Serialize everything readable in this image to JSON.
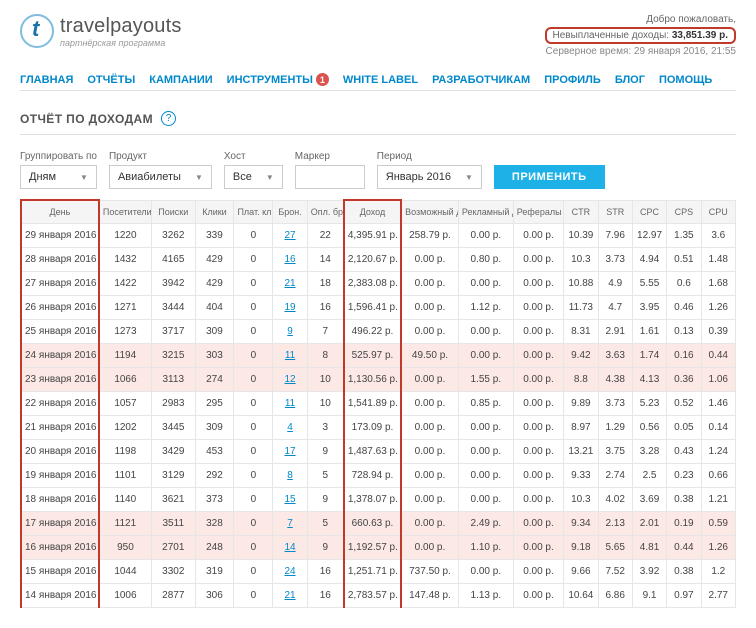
{
  "brand": {
    "title": "travelpayouts",
    "subtitle": "партнёрская программа"
  },
  "header": {
    "welcome": "Добро пожаловать,",
    "unpaid_label": "Невыплаченные доходы:",
    "unpaid_amount": "33,851.39 р.",
    "server_time": "Серверное время: 29 января 2016, 21:55"
  },
  "nav": {
    "main": "ГЛАВНАЯ",
    "reports": "ОТЧЁТЫ",
    "campaigns": "КАМПАНИИ",
    "tools": "ИНСТРУМЕНТЫ",
    "tools_badge": "1",
    "whitelabel": "WHITE LABEL",
    "devs": "РАЗРАБОТЧИКАМ",
    "profile": "ПРОФИЛЬ",
    "blog": "БЛОГ",
    "help": "ПОМОЩЬ"
  },
  "report": {
    "title": "ОТЧЁТ ПО ДОХОДАМ"
  },
  "filters": {
    "group_label": "Группировать по",
    "group_value": "Дням",
    "product_label": "Продукт",
    "product_value": "Авиабилеты",
    "host_label": "Хост",
    "host_value": "Все",
    "marker_label": "Маркер",
    "marker_value": "",
    "period_label": "Период",
    "period_value": "Январь 2016",
    "apply": "ПРИМЕНИТЬ"
  },
  "columns": {
    "day": "День",
    "visitors": "Посетители",
    "searches": "Поиски",
    "clicks": "Клики",
    "paid_clicks": "Плат. клики",
    "bookings": "Брон.",
    "paid_bookings": "Опл. брон.",
    "income": "Доход",
    "possible_income": "Возможный доход",
    "ad_income": "Рекламный доход",
    "referrals": "Рефералы",
    "ctr": "CTR",
    "str": "STR",
    "cpc": "CPC",
    "cps": "CPS",
    "cpu": "CPU"
  },
  "rows": [
    {
      "day": "29 января 2016",
      "v": "1220",
      "s": "3262",
      "c": "339",
      "pc": "0",
      "b": "27",
      "pb": "22",
      "inc": "4,395.91 р.",
      "pos": "258.79 р.",
      "ad": "0.00 р.",
      "ref": "0.00 р.",
      "ctr": "10.39",
      "str": "7.96",
      "cpc": "12.97",
      "cps": "1.35",
      "cpu": "3.6",
      "hl": false
    },
    {
      "day": "28 января 2016",
      "v": "1432",
      "s": "4165",
      "c": "429",
      "pc": "0",
      "b": "16",
      "pb": "14",
      "inc": "2,120.67 р.",
      "pos": "0.00 р.",
      "ad": "0.80 р.",
      "ref": "0.00 р.",
      "ctr": "10.3",
      "str": "3.73",
      "cpc": "4.94",
      "cps": "0.51",
      "cpu": "1.48",
      "hl": false
    },
    {
      "day": "27 января 2016",
      "v": "1422",
      "s": "3942",
      "c": "429",
      "pc": "0",
      "b": "21",
      "pb": "18",
      "inc": "2,383.08 р.",
      "pos": "0.00 р.",
      "ad": "0.00 р.",
      "ref": "0.00 р.",
      "ctr": "10.88",
      "str": "4.9",
      "cpc": "5.55",
      "cps": "0.6",
      "cpu": "1.68",
      "hl": false
    },
    {
      "day": "26 января 2016",
      "v": "1271",
      "s": "3444",
      "c": "404",
      "pc": "0",
      "b": "19",
      "pb": "16",
      "inc": "1,596.41 р.",
      "pos": "0.00 р.",
      "ad": "1.12 р.",
      "ref": "0.00 р.",
      "ctr": "11.73",
      "str": "4.7",
      "cpc": "3.95",
      "cps": "0.46",
      "cpu": "1.26",
      "hl": false
    },
    {
      "day": "25 января 2016",
      "v": "1273",
      "s": "3717",
      "c": "309",
      "pc": "0",
      "b": "9",
      "pb": "7",
      "inc": "496.22 р.",
      "pos": "0.00 р.",
      "ad": "0.00 р.",
      "ref": "0.00 р.",
      "ctr": "8.31",
      "str": "2.91",
      "cpc": "1.61",
      "cps": "0.13",
      "cpu": "0.39",
      "hl": false
    },
    {
      "day": "24 января 2016",
      "v": "1194",
      "s": "3215",
      "c": "303",
      "pc": "0",
      "b": "11",
      "pb": "8",
      "inc": "525.97 р.",
      "pos": "49.50 р.",
      "ad": "0.00 р.",
      "ref": "0.00 р.",
      "ctr": "9.42",
      "str": "3.63",
      "cpc": "1.74",
      "cps": "0.16",
      "cpu": "0.44",
      "hl": true
    },
    {
      "day": "23 января 2016",
      "v": "1066",
      "s": "3113",
      "c": "274",
      "pc": "0",
      "b": "12",
      "pb": "10",
      "inc": "1,130.56 р.",
      "pos": "0.00 р.",
      "ad": "1.55 р.",
      "ref": "0.00 р.",
      "ctr": "8.8",
      "str": "4.38",
      "cpc": "4.13",
      "cps": "0.36",
      "cpu": "1.06",
      "hl": true
    },
    {
      "day": "22 января 2016",
      "v": "1057",
      "s": "2983",
      "c": "295",
      "pc": "0",
      "b": "11",
      "pb": "10",
      "inc": "1,541.89 р.",
      "pos": "0.00 р.",
      "ad": "0.85 р.",
      "ref": "0.00 р.",
      "ctr": "9.89",
      "str": "3.73",
      "cpc": "5.23",
      "cps": "0.52",
      "cpu": "1.46",
      "hl": false
    },
    {
      "day": "21 января 2016",
      "v": "1202",
      "s": "3445",
      "c": "309",
      "pc": "0",
      "b": "4",
      "pb": "3",
      "inc": "173.09 р.",
      "pos": "0.00 р.",
      "ad": "0.00 р.",
      "ref": "0.00 р.",
      "ctr": "8.97",
      "str": "1.29",
      "cpc": "0.56",
      "cps": "0.05",
      "cpu": "0.14",
      "hl": false
    },
    {
      "day": "20 января 2016",
      "v": "1198",
      "s": "3429",
      "c": "453",
      "pc": "0",
      "b": "17",
      "pb": "9",
      "inc": "1,487.63 р.",
      "pos": "0.00 р.",
      "ad": "0.00 р.",
      "ref": "0.00 р.",
      "ctr": "13.21",
      "str": "3.75",
      "cpc": "3.28",
      "cps": "0.43",
      "cpu": "1.24",
      "hl": false
    },
    {
      "day": "19 января 2016",
      "v": "1101",
      "s": "3129",
      "c": "292",
      "pc": "0",
      "b": "8",
      "pb": "5",
      "inc": "728.94 р.",
      "pos": "0.00 р.",
      "ad": "0.00 р.",
      "ref": "0.00 р.",
      "ctr": "9.33",
      "str": "2.74",
      "cpc": "2.5",
      "cps": "0.23",
      "cpu": "0.66",
      "hl": false
    },
    {
      "day": "18 января 2016",
      "v": "1140",
      "s": "3621",
      "c": "373",
      "pc": "0",
      "b": "15",
      "pb": "9",
      "inc": "1,378.07 р.",
      "pos": "0.00 р.",
      "ad": "0.00 р.",
      "ref": "0.00 р.",
      "ctr": "10.3",
      "str": "4.02",
      "cpc": "3.69",
      "cps": "0.38",
      "cpu": "1.21",
      "hl": false
    },
    {
      "day": "17 января 2016",
      "v": "1121",
      "s": "3511",
      "c": "328",
      "pc": "0",
      "b": "7",
      "pb": "5",
      "inc": "660.63 р.",
      "pos": "0.00 р.",
      "ad": "2.49 р.",
      "ref": "0.00 р.",
      "ctr": "9.34",
      "str": "2.13",
      "cpc": "2.01",
      "cps": "0.19",
      "cpu": "0.59",
      "hl": true
    },
    {
      "day": "16 января 2016",
      "v": "950",
      "s": "2701",
      "c": "248",
      "pc": "0",
      "b": "14",
      "pb": "9",
      "inc": "1,192.57 р.",
      "pos": "0.00 р.",
      "ad": "1.10 р.",
      "ref": "0.00 р.",
      "ctr": "9.18",
      "str": "5.65",
      "cpc": "4.81",
      "cps": "0.44",
      "cpu": "1.26",
      "hl": true
    },
    {
      "day": "15 января 2016",
      "v": "1044",
      "s": "3302",
      "c": "319",
      "pc": "0",
      "b": "24",
      "pb": "16",
      "inc": "1,251.71 р.",
      "pos": "737.50 р.",
      "ad": "0.00 р.",
      "ref": "0.00 р.",
      "ctr": "9.66",
      "str": "7.52",
      "cpc": "3.92",
      "cps": "0.38",
      "cpu": "1.2",
      "hl": false
    },
    {
      "day": "14 января 2016",
      "v": "1006",
      "s": "2877",
      "c": "306",
      "pc": "0",
      "b": "21",
      "pb": "16",
      "inc": "2,783.57 р.",
      "pos": "147.48 р.",
      "ad": "1.13 р.",
      "ref": "0.00 р.",
      "ctr": "10.64",
      "str": "6.86",
      "cpc": "9.1",
      "cps": "0.97",
      "cpu": "2.77",
      "hl": false
    }
  ]
}
